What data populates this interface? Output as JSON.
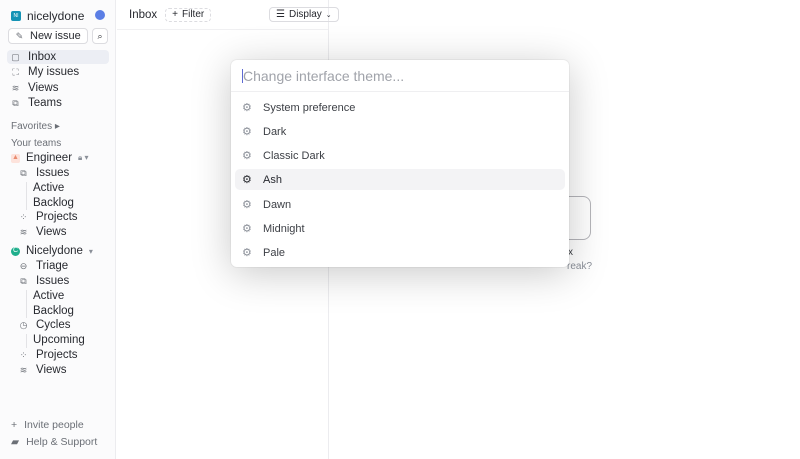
{
  "workspace": {
    "name": "nicelydone",
    "logo": "NI"
  },
  "sidebar": {
    "new_issue": "New issue",
    "nav": [
      {
        "label": "Inbox",
        "icon": "inbox-icon"
      },
      {
        "label": "My issues",
        "icon": "my-issues-icon"
      },
      {
        "label": "Views",
        "icon": "views-icon"
      },
      {
        "label": "Teams",
        "icon": "teams-icon"
      }
    ],
    "favorites": "Favorites",
    "your_teams": "Your teams",
    "teams": [
      {
        "name": "Engineer",
        "items": [
          "Issues",
          "Active",
          "Backlog",
          "Projects",
          "Views"
        ]
      },
      {
        "name": "Nicelydone",
        "items": [
          "Triage",
          "Issues",
          "Active",
          "Backlog",
          "Cycles",
          "Upcoming",
          "Projects",
          "Views"
        ]
      }
    ],
    "invite": "Invite people",
    "help": "Help & Support"
  },
  "inbox": {
    "title": "Inbox",
    "filter": "Filter",
    "display": "Display",
    "empty_partial_1": "x",
    "empty_partial_2": "reak?"
  },
  "modal": {
    "placeholder": "Change interface theme...",
    "options": [
      "System preference",
      "Dark",
      "Classic Dark",
      "Ash",
      "Dawn",
      "Midnight",
      "Pale"
    ],
    "selected": "Ash"
  },
  "colors": {
    "accent": "#5e6ad2",
    "workspace_logo": "#1593b5",
    "selected_bg": "#f3f3f5"
  }
}
